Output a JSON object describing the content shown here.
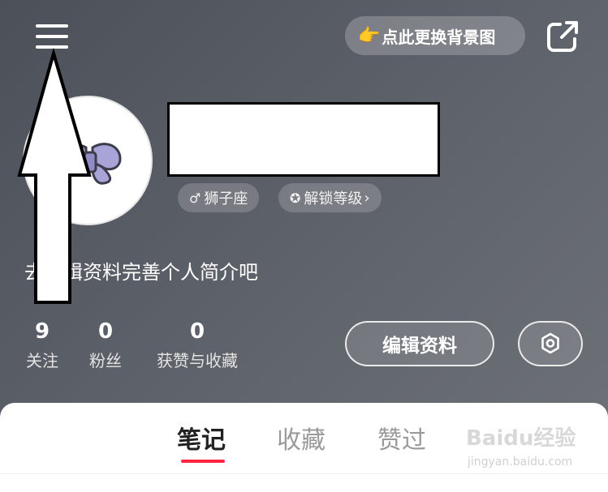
{
  "header": {
    "menu_icon": "hamburger-menu-icon",
    "change_background_label": "点此更换背景图",
    "change_background_icon": "pointing-hand-icon",
    "share_icon": "share-external-icon"
  },
  "profile": {
    "avatar_icon": "bow-avatar-icon",
    "tags": [
      {
        "icon": "male-icon",
        "label": "狮子座"
      },
      {
        "icon": "medal-icon",
        "label": "解锁等级"
      }
    ],
    "bio": "去编辑资料完善个人简介吧"
  },
  "stats": [
    {
      "value": "9",
      "label": "关注"
    },
    {
      "value": "0",
      "label": "粉丝"
    },
    {
      "value": "0",
      "label": "获赞与收藏"
    }
  ],
  "actions": {
    "edit_profile_label": "编辑资料",
    "settings_icon": "gear-icon"
  },
  "tabs": [
    {
      "label": "笔记",
      "active": true
    },
    {
      "label": "收藏",
      "active": false
    },
    {
      "label": "赞过",
      "active": false
    }
  ],
  "colors": {
    "accent": "#ff2442",
    "header_bg": "#5c6068"
  },
  "watermark": {
    "brand": "Baidu经验",
    "url": "jingyan.baidu.com"
  }
}
